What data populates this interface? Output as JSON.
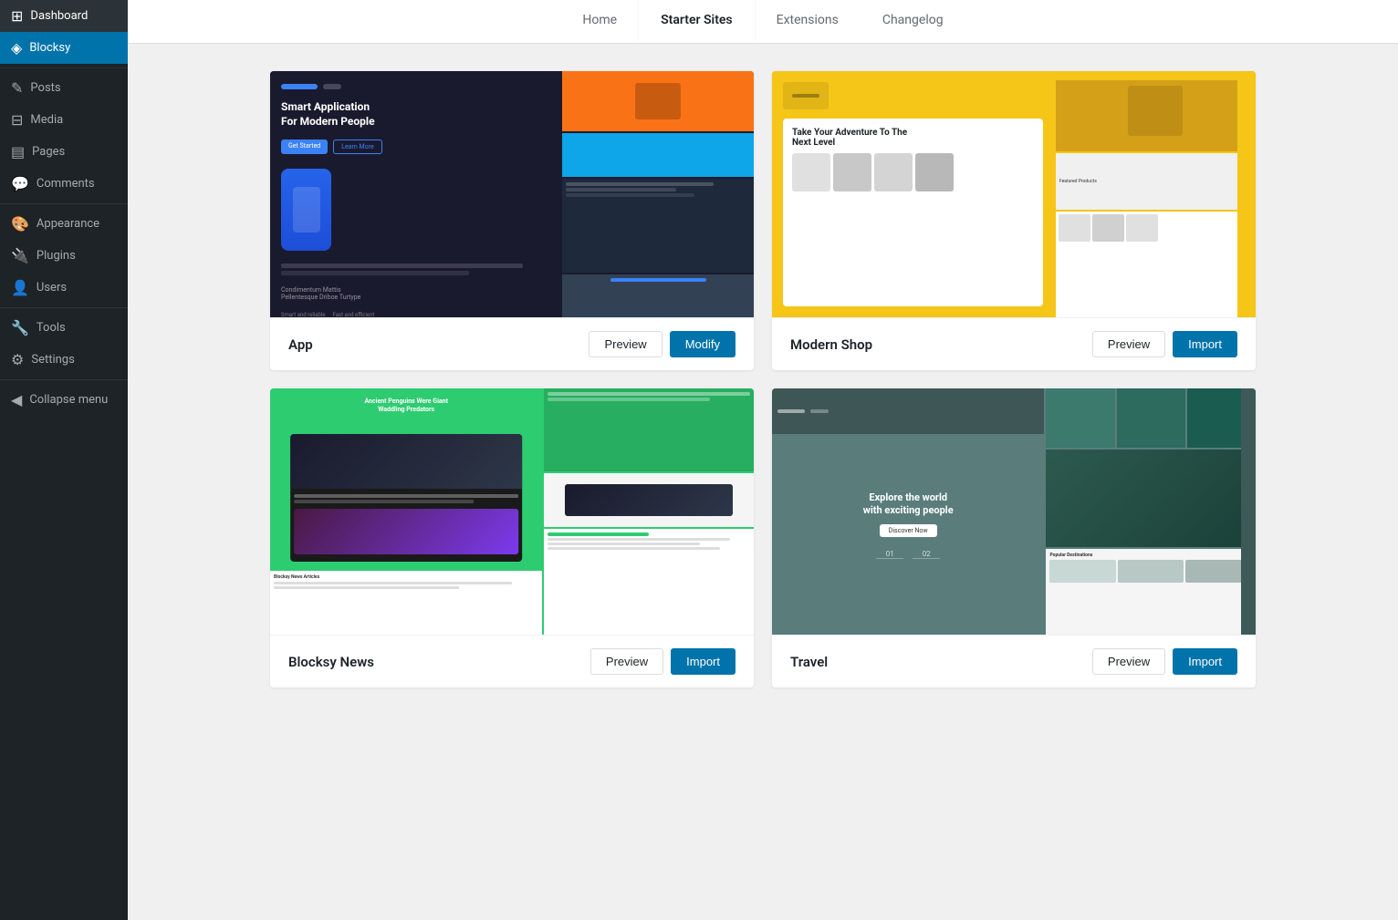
{
  "sidebar": {
    "items": [
      {
        "id": "dashboard",
        "label": "Dashboard",
        "icon": "⊞",
        "active": false
      },
      {
        "id": "blocksy",
        "label": "Blocksy",
        "icon": "◈",
        "active": true
      },
      {
        "id": "posts",
        "label": "Posts",
        "icon": "✎",
        "active": false
      },
      {
        "id": "media",
        "label": "Media",
        "icon": "⊟",
        "active": false
      },
      {
        "id": "pages",
        "label": "Pages",
        "icon": "▤",
        "active": false
      },
      {
        "id": "comments",
        "label": "Comments",
        "icon": "💬",
        "active": false
      },
      {
        "id": "appearance",
        "label": "Appearance",
        "icon": "🎨",
        "active": false
      },
      {
        "id": "plugins",
        "label": "Plugins",
        "icon": "🔌",
        "active": false
      },
      {
        "id": "users",
        "label": "Users",
        "icon": "👤",
        "active": false
      },
      {
        "id": "tools",
        "label": "Tools",
        "icon": "🔧",
        "active": false
      },
      {
        "id": "settings",
        "label": "Settings",
        "icon": "⚙",
        "active": false
      },
      {
        "id": "collapse",
        "label": "Collapse menu",
        "icon": "◀",
        "active": false
      }
    ]
  },
  "tabs": [
    {
      "id": "home",
      "label": "Home",
      "active": false
    },
    {
      "id": "starter-sites",
      "label": "Starter Sites",
      "active": true
    },
    {
      "id": "extensions",
      "label": "Extensions",
      "active": false
    },
    {
      "id": "changelog",
      "label": "Changelog",
      "active": false
    }
  ],
  "cards": [
    {
      "id": "app",
      "title": "App",
      "theme": "app",
      "preview_label": "Preview",
      "action_label": "Modify",
      "action_primary": true
    },
    {
      "id": "modern-shop",
      "title": "Modern Shop",
      "theme": "shop",
      "preview_label": "Preview",
      "action_label": "Import",
      "action_primary": true
    },
    {
      "id": "blocksy-news",
      "title": "Blocksy News",
      "theme": "news",
      "preview_label": "Preview",
      "action_label": "Import",
      "action_primary": true
    },
    {
      "id": "travel",
      "title": "Travel",
      "theme": "travel",
      "preview_label": "Preview",
      "action_label": "Import",
      "action_primary": true
    }
  ],
  "colors": {
    "sidebar_bg": "#1d2327",
    "sidebar_active": "#0073aa",
    "primary_btn": "#0073aa"
  }
}
